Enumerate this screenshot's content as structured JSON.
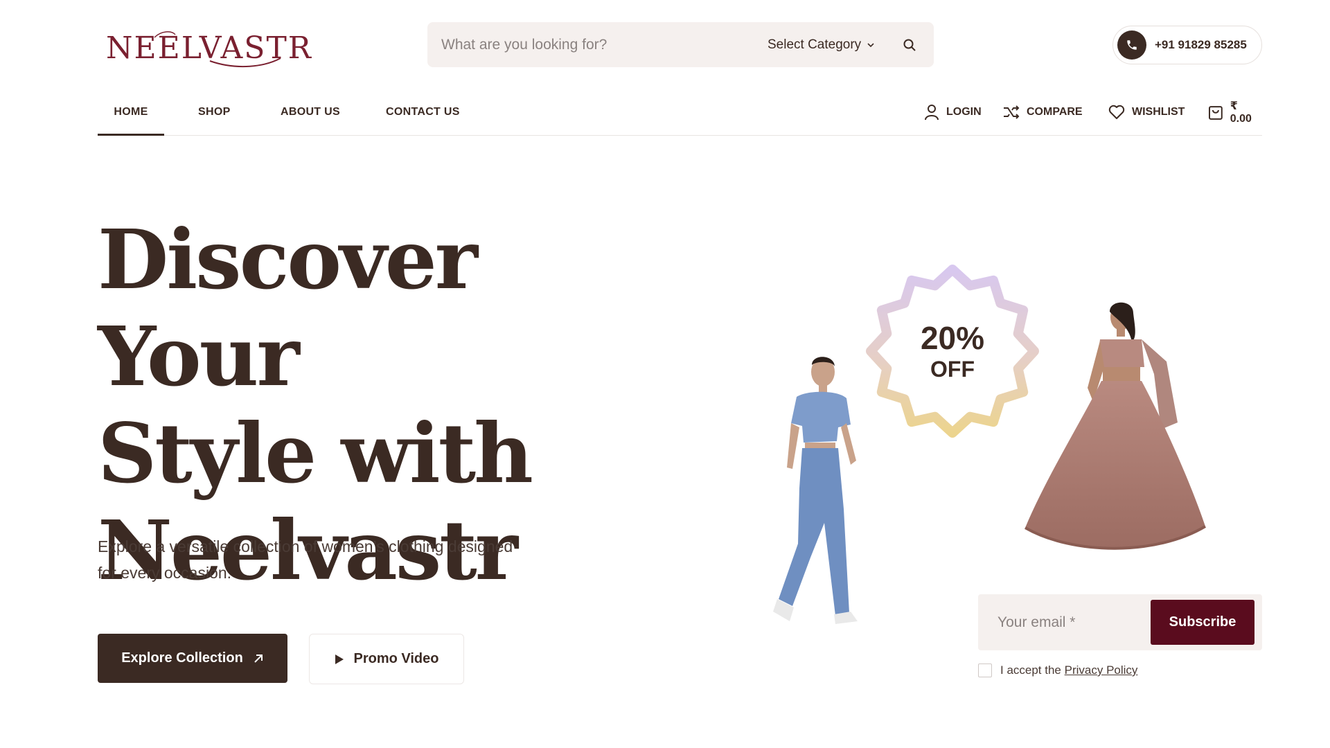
{
  "brand": {
    "logo_text": "NEELVASTR"
  },
  "search": {
    "placeholder": "What are you looking for?",
    "category_label": "Select Category"
  },
  "contact": {
    "phone": "+91 91829 85285"
  },
  "nav": {
    "items": [
      {
        "label": "HOME",
        "active": true
      },
      {
        "label": "SHOP"
      },
      {
        "label": "ABOUT US"
      },
      {
        "label": "CONTACT US"
      }
    ],
    "login": "LOGIN",
    "compare": "COMPARE",
    "wishlist": "WISHLIST",
    "cart_total": "₹ 0.00"
  },
  "hero": {
    "title_lines": [
      "Discover Your",
      "Style with",
      "Neelvastr"
    ],
    "description": "Explore a versatile collection of women’s clothing designed for every occasion.",
    "explore_label": "Explore Collection",
    "promo_label": "Promo Video"
  },
  "badge": {
    "percent": "20%",
    "off": "OFF"
  },
  "newsletter": {
    "email_placeholder": "Your email *",
    "subscribe_label": "Subscribe",
    "accept_text": "I accept the",
    "privacy_link": "Privacy Policy"
  },
  "colors": {
    "primary": "#3b2a23",
    "accent": "#5a0c1e",
    "logo": "#7a2030",
    "surface": "#f5f0ee"
  },
  "icons": [
    "phone-icon",
    "search-icon",
    "chevron-down-icon",
    "user-icon",
    "compare-icon",
    "heart-icon",
    "bag-icon",
    "arrow-up-right-icon",
    "play-icon"
  ]
}
